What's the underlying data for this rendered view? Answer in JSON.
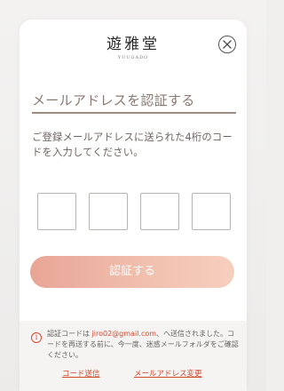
{
  "brand": {
    "name": "遊雅堂",
    "romanized": "YUUGADO"
  },
  "close_icon": "close-circle-x-icon",
  "title": "メールアドレスを認証する",
  "instruction": "ご登録メールアドレスに送られた4桁のコードを入力してください。",
  "code_inputs": [
    {
      "value": "",
      "placeholder": ""
    },
    {
      "value": "",
      "placeholder": ""
    },
    {
      "value": "",
      "placeholder": ""
    },
    {
      "value": "",
      "placeholder": ""
    }
  ],
  "verify_button_label": "認証する",
  "notice": {
    "icon": "info-icon",
    "text_before": "認証コードは ",
    "email": "jiro02@gmail.com",
    "text_after": "、へ送信されました。コードを再送する前に、今一度、迷惑メールフォルダをご確認ください。"
  },
  "links": {
    "resend": "コード送信",
    "change_email": "メールアドレス変更"
  },
  "colors": {
    "accent": "#d2472f",
    "button_gradient_start": "#e8a596",
    "button_gradient_end": "#f6cfbf",
    "title_text": "#8a7870"
  }
}
